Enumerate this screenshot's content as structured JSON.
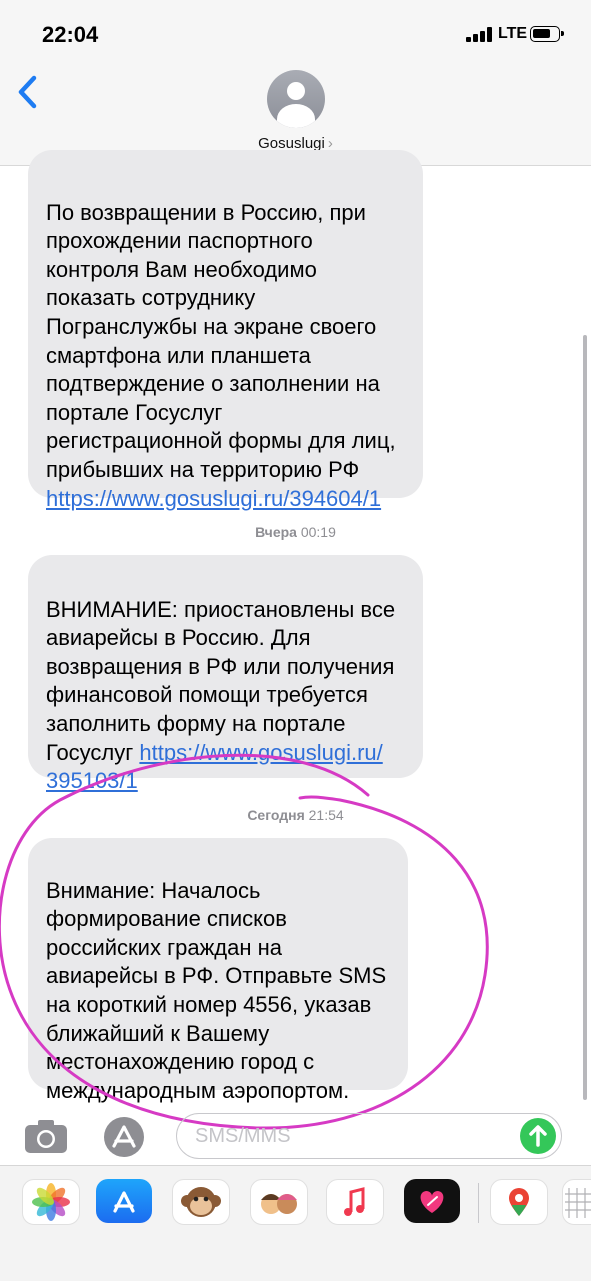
{
  "status_bar": {
    "time": "22:04",
    "network": "LTE"
  },
  "header": {
    "contact_name": "Gosuslugi",
    "chevron": "›"
  },
  "messages": [
    {
      "text": "По возвращении в Россию, при\nпрохождении паспортного\nконтроля Вам необходимо\nпоказать сотруднику\nПогранслужбы на экране своего\nсмартфона или планшета\nподтверждение о заполнении на\nпортале Госуслуг\nрегистрационной формы для лиц,\nприбывших на территорию РФ\n",
      "link": "https://www.gosuslugi.ru/394604/1"
    },
    {
      "timestamp_day": "Вчера",
      "timestamp_time": "00:19",
      "text": "ВНИМАНИЕ: приостановлены все\nавиарейсы в Россию. Для\nвозвращения в РФ или получения\nфинансовой помощи требуется\nзаполнить форму на портале\nГосуслуг  ",
      "link": "https://www.gosuslugi.ru/\n395103/1"
    },
    {
      "timestamp_day": "Сегодня",
      "timestamp_time": "21:54",
      "text": "Внимание: Началось\nформирование списков\nроссийских граждан на\nавиарейсы в РФ. Отправьте SMS\nна короткий номер 4556, указав\nближайший к Вашему\nместонахождению город с\nмеждународным аэропортом."
    }
  ],
  "composer": {
    "placeholder": "SMS/MMS"
  },
  "icons": {
    "back": "chevron-left-icon",
    "camera": "camera-icon",
    "apps": "app-store-icon",
    "send": "send-arrow-icon"
  },
  "colors": {
    "accent": "#007aff",
    "bubble": "#e9e9eb",
    "annotation": "#d63ac4",
    "send": "#34c759"
  }
}
